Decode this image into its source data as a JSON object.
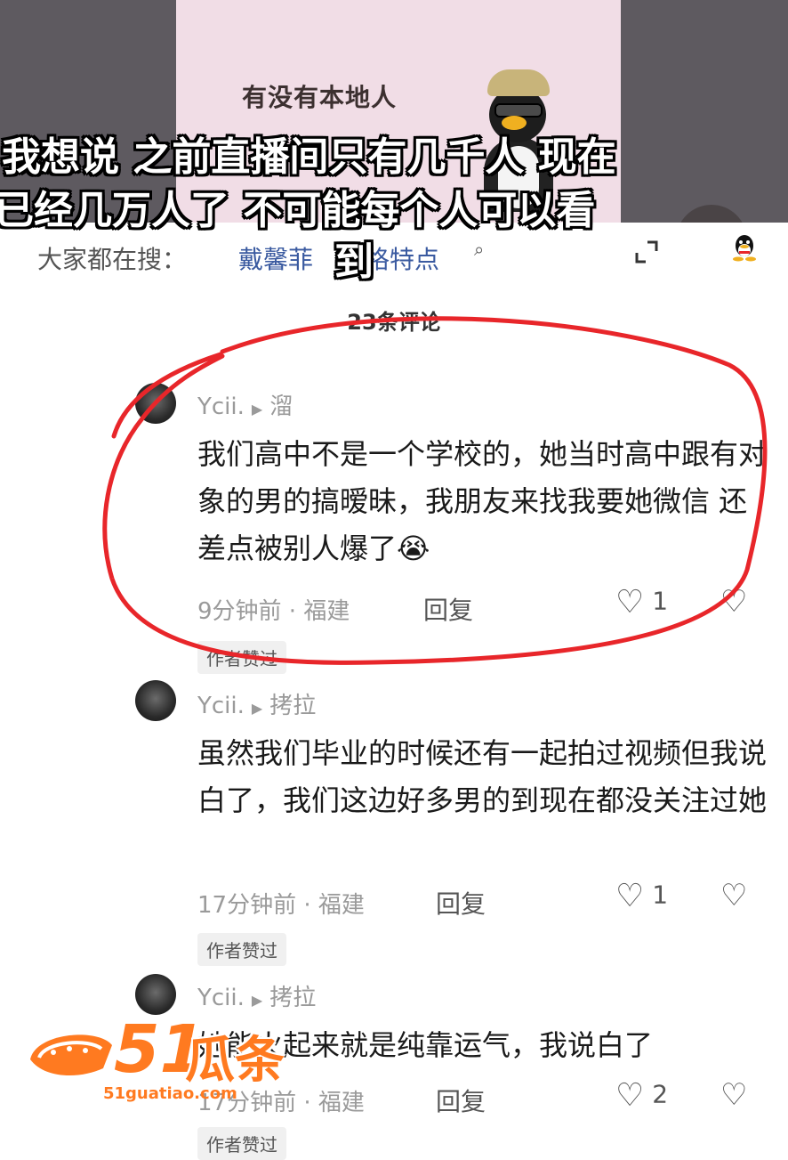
{
  "video": {
    "panel_text": "有没有本地人",
    "caption_lines": [
      "我想说 之前直播间只有几千人 现在",
      "已经几万人了 不可能每个人可以看",
      "到"
    ]
  },
  "search": {
    "label": "大家都在搜：",
    "term": "戴馨菲",
    "term_tail": "格特点",
    "search_icon": "search-icon",
    "expand_icon": "expand-icon",
    "qq_icon": "qq-icon"
  },
  "comments_header": {
    "count_text": "23条评论"
  },
  "comments": [
    {
      "user": "Ycii.",
      "reply_to": "溜",
      "text": "我们高中不是一个学校的，她当时高中跟有对象的男的搞暧昧，我朋友来找我要她微信 还差点被别人爆了😭",
      "time_loc": "9分钟前 · 福建",
      "reply_label": "回复",
      "likes": "1",
      "badge": "作者赞过"
    },
    {
      "user": "Ycii.",
      "reply_to": "拷拉",
      "text": "虽然我们毕业的时候还有一起拍过视频但我说白了，我们这边好多男的到现在都没关注过她",
      "time_loc": "17分钟前 · 福建",
      "reply_label": "回复",
      "likes": "1",
      "badge": "作者赞过"
    },
    {
      "user": "Ycii.",
      "reply_to": "拷拉",
      "text": "她能火起来就是纯靠运气，我说白了",
      "time_loc": "17分钟前 · 福建",
      "reply_label": "回复",
      "likes": "2",
      "badge": "作者赞过"
    }
  ],
  "watermark": {
    "num": "51",
    "cn": "瓜条",
    "url": "51guatiao.com"
  },
  "colors": {
    "annotation_red": "#e8262a",
    "watermark_orange": "#ff7a20",
    "link_blue": "#3a5aa0"
  }
}
